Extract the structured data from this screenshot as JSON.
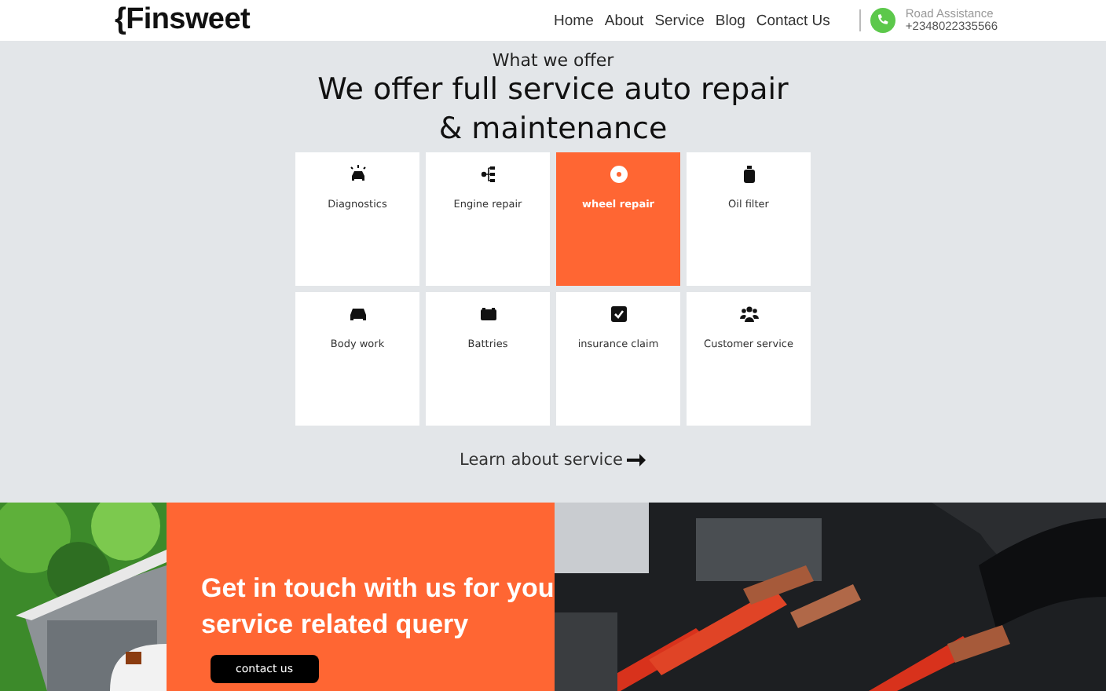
{
  "header": {
    "logo": "{Finsweet",
    "nav": [
      {
        "label": "Home"
      },
      {
        "label": "About"
      },
      {
        "label": "Service"
      },
      {
        "label": "Blog"
      },
      {
        "label": "Contact Us"
      }
    ],
    "assistance": {
      "label": "Road Assistance",
      "phone": "+2348022335566"
    }
  },
  "services": {
    "eyebrow": "What we offer",
    "title": "We offer full service auto repair & maintenance",
    "items": [
      {
        "label": "Diagnostics",
        "selected": false
      },
      {
        "label": "Engine repair",
        "selected": false
      },
      {
        "label": "wheel repair",
        "selected": true
      },
      {
        "label": "Oil filter",
        "selected": false
      },
      {
        "label": "Body work",
        "selected": false
      },
      {
        "label": "Battries",
        "selected": false
      },
      {
        "label": "insurance claim",
        "selected": false
      },
      {
        "label": "Customer service",
        "selected": false
      }
    ],
    "link": "Learn about service"
  },
  "contact": {
    "title": "Get in touch with us for you service related query",
    "button": "contact us"
  }
}
